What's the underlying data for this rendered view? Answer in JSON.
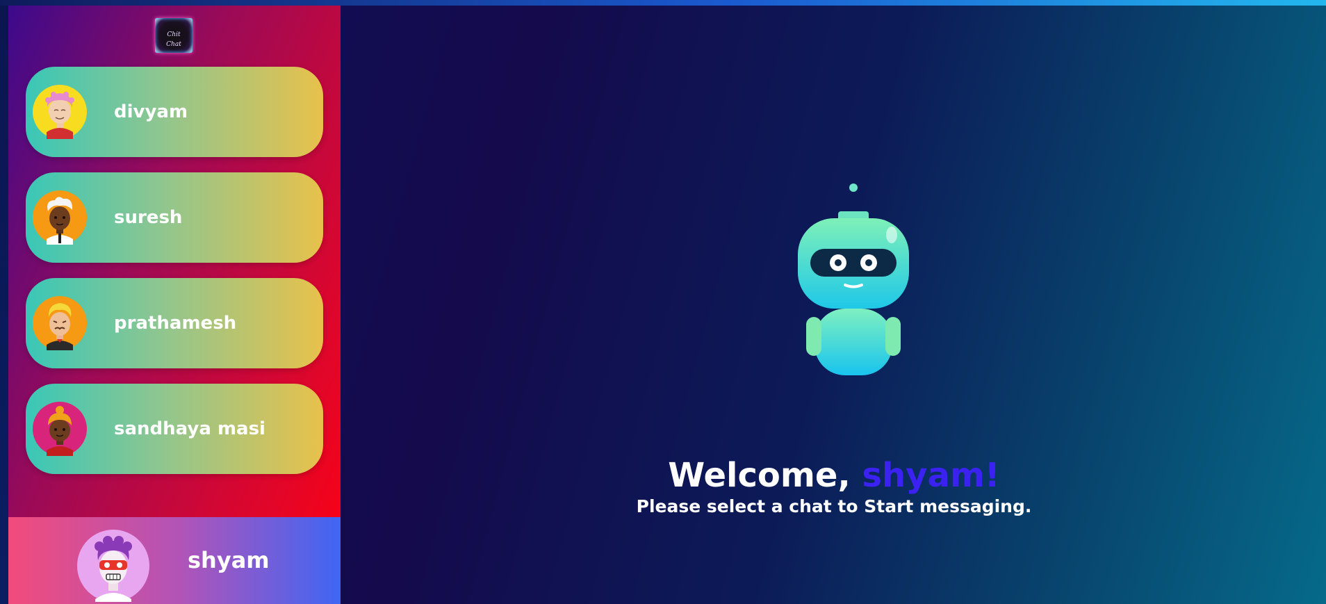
{
  "app": {
    "logo_text": "Chit Chat"
  },
  "sidebar": {
    "chats": [
      {
        "name": "divyam",
        "avatar": "avatar-divyam-icon"
      },
      {
        "name": "suresh",
        "avatar": "avatar-suresh-icon"
      },
      {
        "name": "prathamesh",
        "avatar": "avatar-prathamesh-icon"
      },
      {
        "name": "sandhaya masi",
        "avatar": "avatar-sandhaya-icon"
      }
    ]
  },
  "current_user": {
    "name": "shyam",
    "avatar": "avatar-shyam-icon"
  },
  "main": {
    "welcome_prefix": "Welcome, ",
    "welcome_name": "shyam!",
    "hint": "Please select a chat to Start messaging.",
    "illustration": "robot-icon"
  },
  "colors": {
    "welcome_name": "#3c22f2",
    "chat_item_start": "#39c7b7",
    "chat_item_end": "#e8c14b"
  }
}
